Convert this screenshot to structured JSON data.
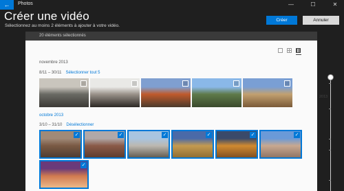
{
  "window": {
    "app_title": "Photos",
    "back_icon": "←",
    "minimize_icon": "—",
    "maximize_icon": "☐",
    "close_icon": "✕"
  },
  "header": {
    "title": "Créer une vidéo",
    "subtitle": "Sélectionnez au moins 2 éléments à ajouter à votre vidéo.",
    "create_label": "Créer",
    "cancel_label": "Annuler"
  },
  "selection": {
    "count_text": "20 éléments sélectionnés"
  },
  "timeline": {
    "year": "2013"
  },
  "groups": [
    {
      "month": "novembre 2013",
      "range": "8/11 – 30/11",
      "action": "Sélectionner tout 5",
      "photos": [
        {
          "name": "rock-coast",
          "selected": false,
          "colors": [
            "#c9c5bd",
            "#6a6a64",
            "#3c3a36"
          ]
        },
        {
          "name": "canyon-rim",
          "selected": false,
          "colors": [
            "#e9e9e6",
            "#9a928a",
            "#2c2824"
          ]
        },
        {
          "name": "red-rock-canyon",
          "selected": false,
          "colors": [
            "#7f9fd0",
            "#c05a2c",
            "#4a3a2c"
          ]
        },
        {
          "name": "desert-mountains",
          "selected": false,
          "colors": [
            "#8ab8e8",
            "#5f7a4a",
            "#3a4a2c"
          ]
        },
        {
          "name": "desert-plain",
          "selected": false,
          "colors": [
            "#7a9fd4",
            "#c2a070",
            "#7a5a38"
          ]
        }
      ]
    },
    {
      "month": "octobre 2013",
      "range": "3/10 – 31/10",
      "action": "Désélectionner",
      "photos": [
        {
          "name": "canyon-overlook",
          "selected": true,
          "colors": [
            "#a08a78",
            "#7a5a44",
            "#4a3a30"
          ]
        },
        {
          "name": "grand-canyon",
          "selected": true,
          "colors": [
            "#b0a8a8",
            "#8a5a48",
            "#5a3a2c"
          ]
        },
        {
          "name": "dunes",
          "selected": true,
          "colors": [
            "#a8c4e0",
            "#bcb8b0",
            "#5a5448"
          ]
        },
        {
          "name": "salt-flat",
          "selected": true,
          "colors": [
            "#4a6aa8",
            "#c49a50",
            "#8a6a30"
          ]
        },
        {
          "name": "sunset-canyon",
          "selected": true,
          "colors": [
            "#3a4a6a",
            "#d08a30",
            "#7a4a20"
          ]
        },
        {
          "name": "las-vegas",
          "selected": true,
          "colors": [
            "#6a9ad8",
            "#c8a890",
            "#8a7060"
          ]
        },
        {
          "name": "antelope-canyon",
          "selected": true,
          "colors": [
            "#6a3a7a",
            "#d07a50",
            "#f0c090"
          ]
        }
      ]
    }
  ]
}
